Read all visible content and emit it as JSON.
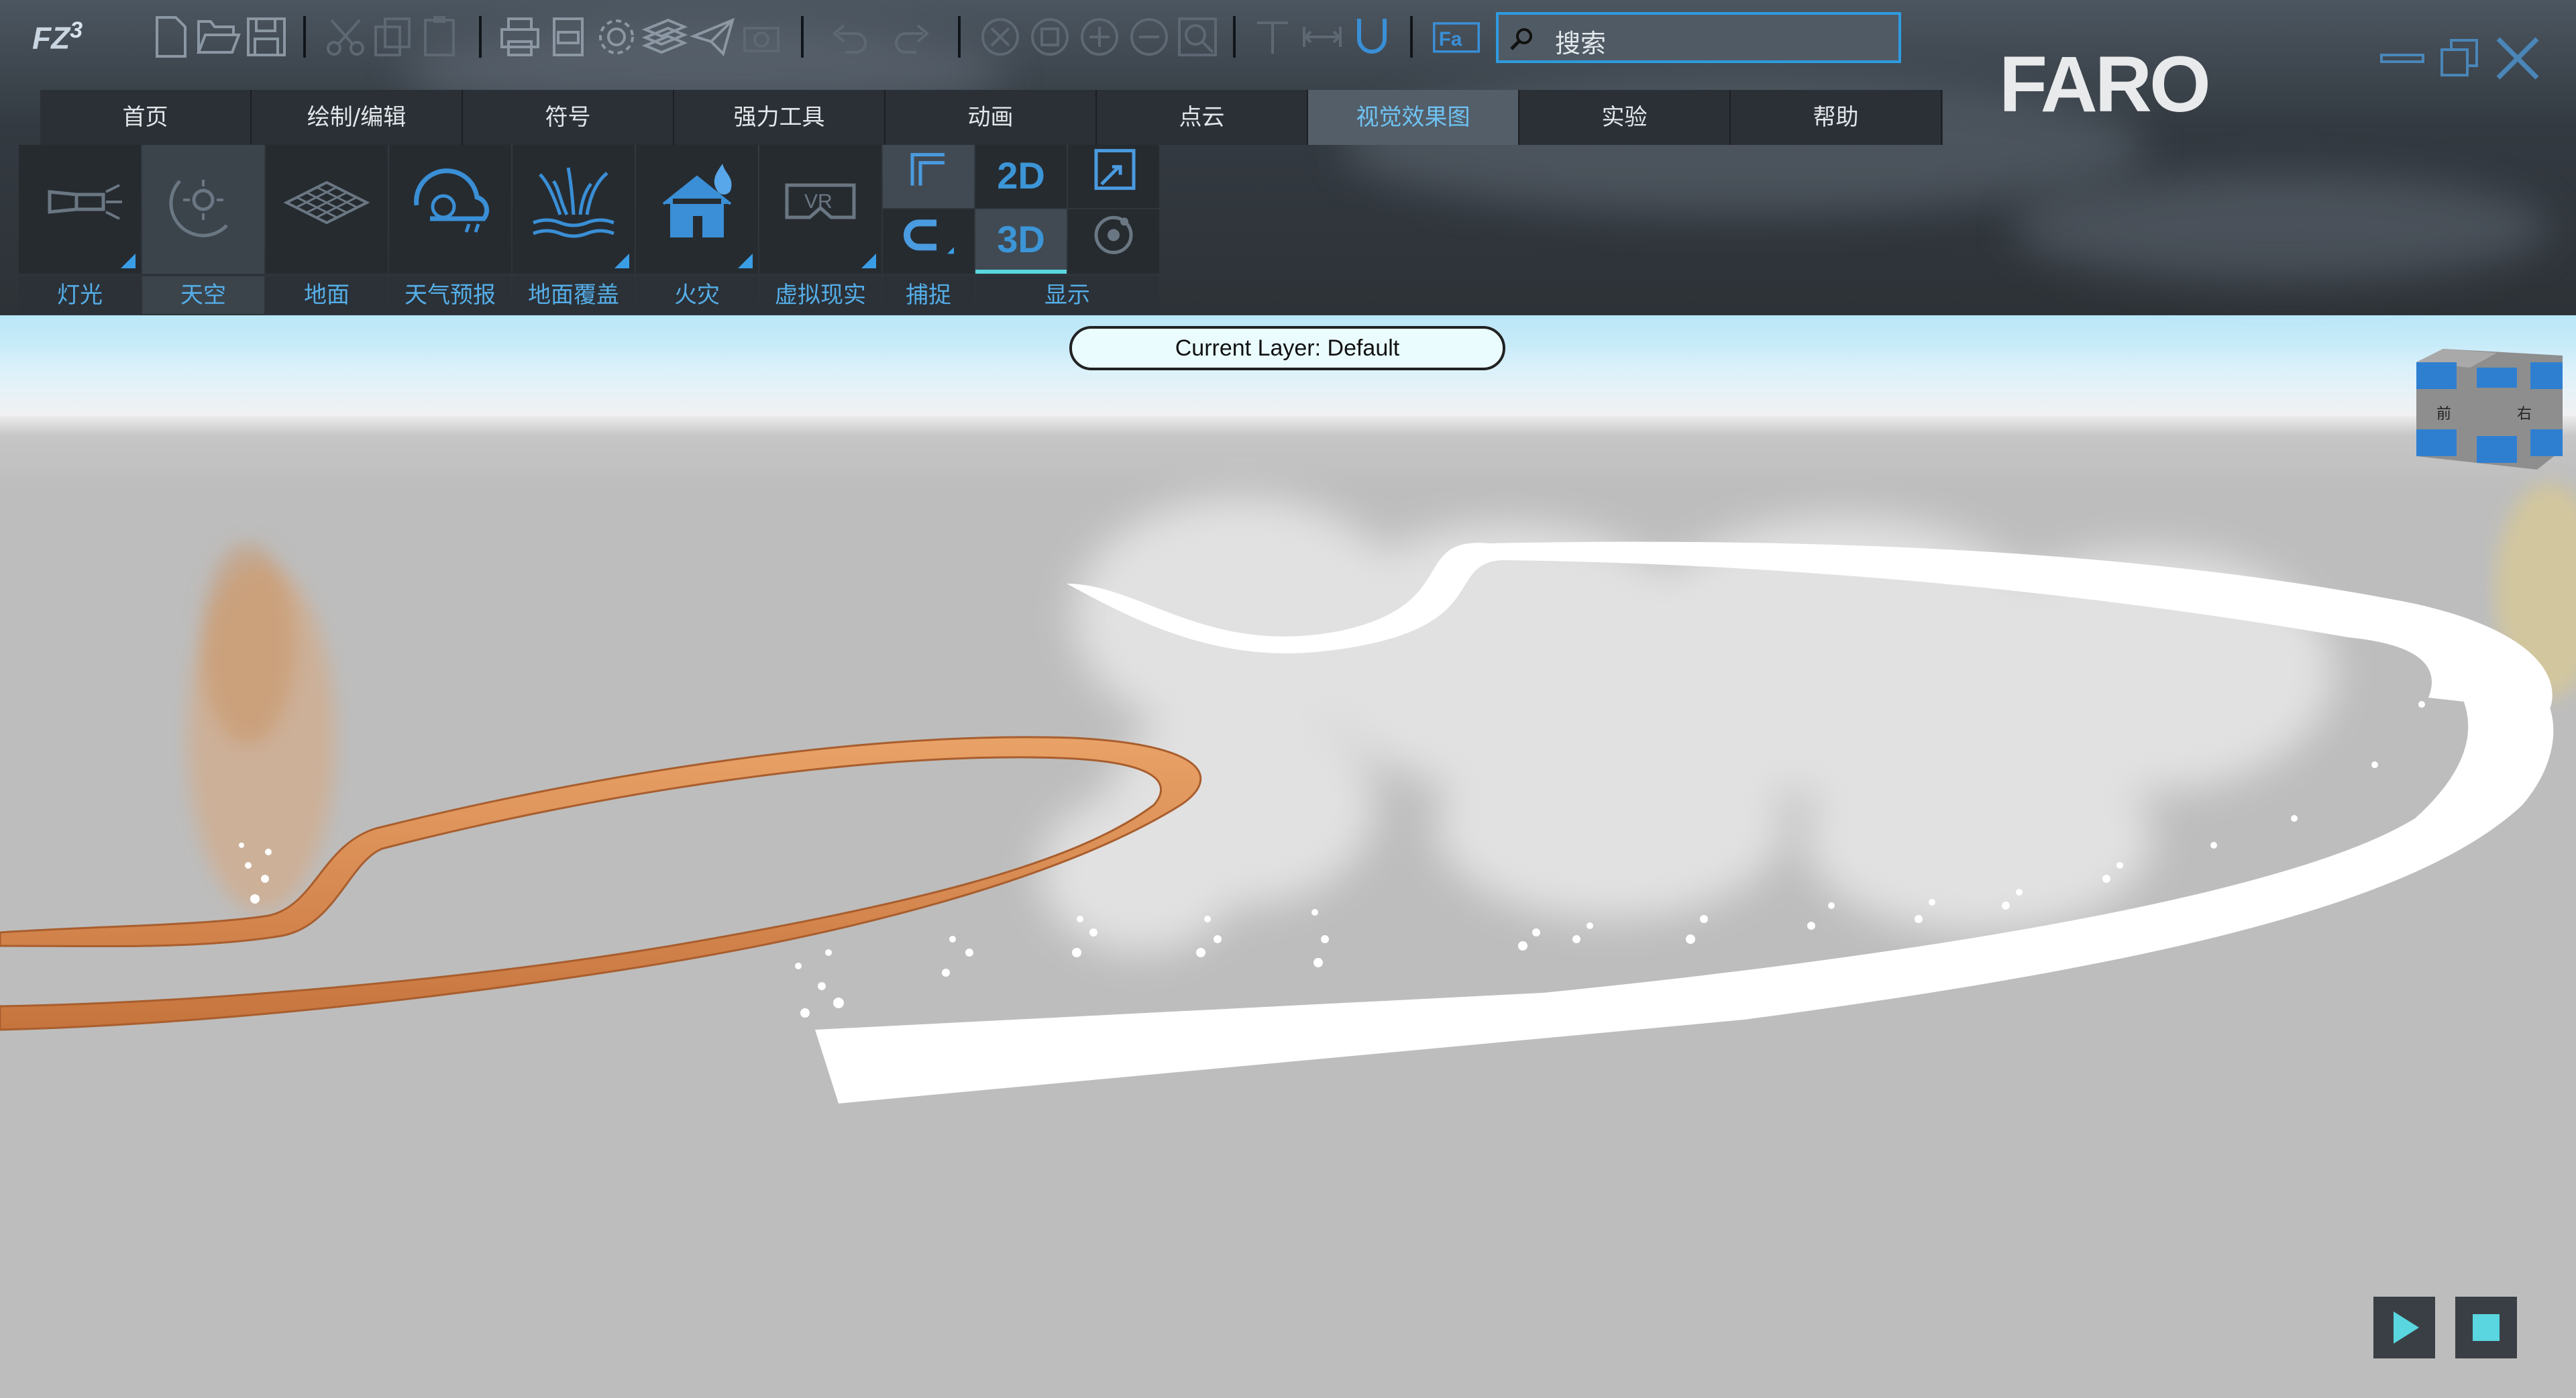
{
  "app": {
    "logo_text": "FZ",
    "logo_sup": "3"
  },
  "search": {
    "placeholder": "搜索"
  },
  "brand": {
    "name": "FARO"
  },
  "tabs": [
    {
      "label": "首页"
    },
    {
      "label": "绘制/编辑"
    },
    {
      "label": "符号"
    },
    {
      "label": "强力工具"
    },
    {
      "label": "动画"
    },
    {
      "label": "点云"
    },
    {
      "label": "视觉效果图",
      "active": true
    },
    {
      "label": "实验"
    },
    {
      "label": "帮助"
    }
  ],
  "ribbon": {
    "lights": {
      "label": "灯光",
      "icon": "flashlight-icon"
    },
    "sky": {
      "label": "天空",
      "icon": "sun-moon-icon"
    },
    "ground": {
      "label": "地面",
      "icon": "grid-plane-icon"
    },
    "weather": {
      "label": "天气预报",
      "icon": "weather-icon"
    },
    "ground_cover": {
      "label": "地面覆盖",
      "icon": "grass-water-icon"
    },
    "fire": {
      "label": "火灾",
      "icon": "house-fire-icon"
    },
    "vr": {
      "label": "虚拟现实",
      "icon": "vr-headset-icon",
      "badge": "VR"
    },
    "snap": {
      "label": "捕捉"
    },
    "display": {
      "label": "显示",
      "mode_2d": "2D",
      "mode_3d": "3D"
    }
  },
  "viewport": {
    "current_layer": "Current Layer: Default",
    "cube_faces": {
      "front": "前",
      "right": "右"
    }
  },
  "colors": {
    "accent": "#3a9ee6",
    "active_tab_text": "#6fc3f2",
    "play_glyph": "#59d6e0",
    "road": "#d98a4e",
    "sky": "#aee3f7"
  }
}
